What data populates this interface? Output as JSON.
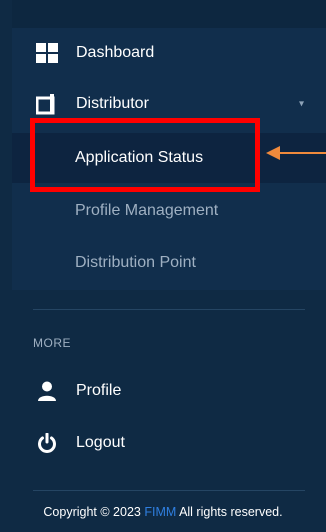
{
  "sidebar": {
    "menu": [
      {
        "label": "Dashboard",
        "icon": "dashboard-grid-icon"
      },
      {
        "label": "Distributor",
        "icon": "distributor-icon",
        "expanded": true
      }
    ],
    "submenu": [
      {
        "label": "Application Status",
        "active": true
      },
      {
        "label": "Profile Management",
        "active": false
      },
      {
        "label": "Distribution Point",
        "active": false
      }
    ],
    "more_heading": "MORE",
    "more_items": [
      {
        "label": "Profile",
        "icon": "user-icon"
      },
      {
        "label": "Logout",
        "icon": "power-icon"
      }
    ]
  },
  "footer": {
    "prefix": "Copyright © 2023 ",
    "brand": "FIMM",
    "suffix": " All rights reserved."
  },
  "colors": {
    "sidebar_bg": "#0f2a44",
    "menu_bg": "#112e4c",
    "highlight": "#ff0000",
    "annotation_arrow": "#f08a3c",
    "brand_link": "#2f7fe0"
  }
}
